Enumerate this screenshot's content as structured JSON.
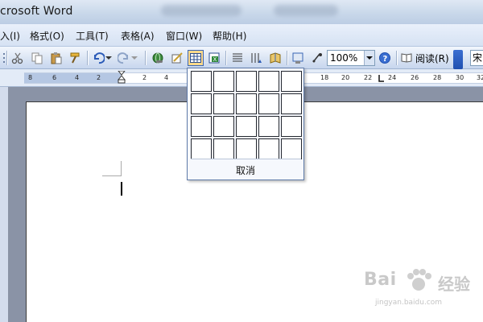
{
  "titlebar": {
    "title": "crosoft Word"
  },
  "menubar": {
    "items": [
      {
        "label": "入(I)"
      },
      {
        "label": "格式(O)"
      },
      {
        "label": "工具(T)"
      },
      {
        "label": "表格(A)"
      },
      {
        "label": "窗口(W)"
      },
      {
        "label": "帮助(H)"
      }
    ]
  },
  "toolbar": {
    "zoom": "100%",
    "read_label": "阅读(R)",
    "font_preview": "宋",
    "icons": [
      "cut-icon",
      "copy-icon",
      "paste-icon",
      "format-painter-icon",
      "undo-icon",
      "redo-icon",
      "hyperlink-icon",
      "tables-borders-icon",
      "insert-table-icon",
      "insert-excel-icon",
      "columns-icon",
      "drawing-icon",
      "document-map-icon",
      "show-hide-icon",
      "zoom-dropdown-icon",
      "help-icon",
      "read-icon"
    ]
  },
  "ruler": {
    "left_numbers": [
      "8",
      "6",
      "4",
      "2"
    ],
    "right_numbers_a": [
      "2",
      "4"
    ],
    "right_numbers_b": [
      "18",
      "20",
      "22",
      "24",
      "26",
      "28",
      "30",
      "32"
    ]
  },
  "table_picker": {
    "rows": 4,
    "cols": 5,
    "cancel_label": "取消"
  },
  "watermark": {
    "logo": "Bai",
    "logo2": "经验",
    "url": "jingyan.baidu.com"
  },
  "colors": {
    "accent": "#1f4fb0",
    "menubar_bg": "#d6e2f3",
    "workspace_bg": "#8a93a6"
  }
}
